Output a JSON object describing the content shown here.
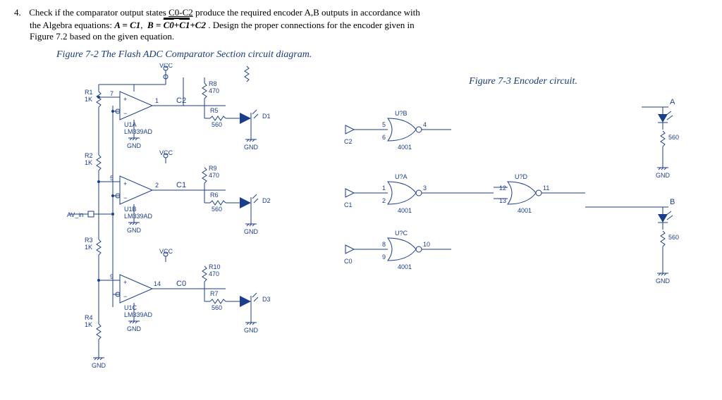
{
  "question": {
    "number": "4.",
    "line1_a": "Check if the comparator output states ",
    "line1_b": " produce the required encoder A,B outputs in accordance with",
    "c_range": "C0-C2",
    "line2_a": "the Algebra equations:  ",
    "eqA": "A = C1",
    "eqB_lhs": "B = ",
    "eqB_term1": "C0",
    "eqB_plus1": "+",
    "eqB_term2": "C1",
    "eqB_plus2": "+",
    "eqB_term3": "C2",
    "line2_b": " . Design the proper connections for the encoder given in",
    "line3": "Figure 7.2 based on the given equation."
  },
  "fig72_caption": "Figure 7-2 The Flash ADC Comparator Section circuit diagram.",
  "fig73_caption": "Figure 7-3 Encoder circuit.",
  "comparator": {
    "vcc": "VCC",
    "gnd": "GND",
    "r1": {
      "name": "R1",
      "val": "1K"
    },
    "r2": {
      "name": "R2",
      "val": "1K"
    },
    "r3": {
      "name": "R3",
      "val": "1K"
    },
    "r4": {
      "name": "R4",
      "val": "1K"
    },
    "r5": {
      "name": "R5",
      "val": "560"
    },
    "r6": {
      "name": "R6",
      "val": "560"
    },
    "r7": {
      "name": "R7",
      "val": "560"
    },
    "r8": {
      "name": "R8",
      "val": "470"
    },
    "r9": {
      "name": "R9",
      "val": "470"
    },
    "r10": {
      "name": "R10",
      "val": "470"
    },
    "u1a": {
      "name": "U1A",
      "part": "LM339AD",
      "out": "1",
      "pin": "7"
    },
    "u1b": {
      "name": "U1B",
      "part": "LM339AD",
      "out": "2",
      "pin": "5"
    },
    "u1c": {
      "name": "U1C",
      "part": "LM339AD",
      "out": "14",
      "pin": "9"
    },
    "c2": "C2",
    "c1": "C1",
    "c0": "C0",
    "d1": "D1",
    "d2": "D2",
    "d3": "D3",
    "avin": "AV_in"
  },
  "encoder": {
    "u2a": {
      "name": "U?A",
      "part": "4001",
      "p1": "1",
      "p2": "2",
      "po": "3"
    },
    "u2b": {
      "name": "U?B",
      "part": "4001",
      "p1": "5",
      "p2": "6",
      "po": "4"
    },
    "u2c": {
      "name": "U?C",
      "part": "4001",
      "p1": "8",
      "p2": "9",
      "po": "10"
    },
    "u2d": {
      "name": "U?D",
      "part": "4001",
      "p1": "12",
      "p2": "13",
      "po": "11"
    },
    "c0": "C0",
    "c1": "C1",
    "c2": "C2",
    "a": "A",
    "b": "B",
    "r560a": "560",
    "r560b": "560",
    "gnd": "GND"
  }
}
